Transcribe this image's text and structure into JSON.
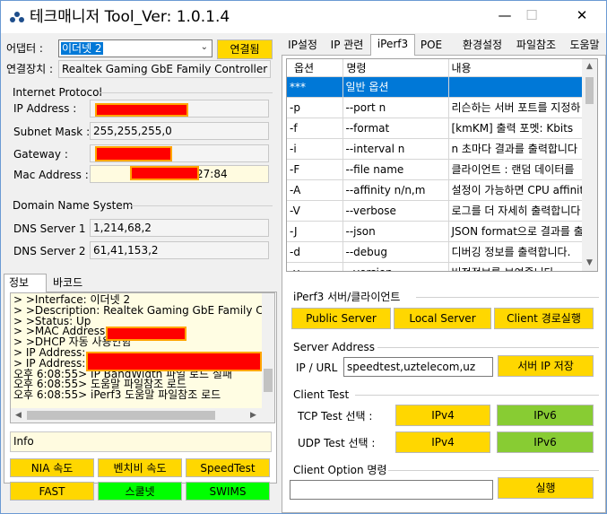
{
  "window": {
    "title": "테크매니저 Tool_Ver: 1.0.1.4",
    "minimize": "—",
    "maximize": "☐",
    "close": "✕"
  },
  "adapter": {
    "label": "어댑터 :",
    "value": "이더넷 2",
    "status_button": "연결됨",
    "device_label": "연결장치 :",
    "device_value": "Realtek Gaming GbE Family Controller"
  },
  "ip": {
    "group_title": "Internet Protocol",
    "address_label": "IP Address :",
    "subnet_label": "Subnet Mask :",
    "subnet_value": "255,255,255,0",
    "gateway_label": "Gateway :",
    "mac_label": "Mac Address :",
    "mac_value": "27:84"
  },
  "dns": {
    "group_title": "Domain Name System",
    "dns1_label": "DNS Server 1 :",
    "dns1_value": "1,214,68,2",
    "dns2_label": "DNS Server 2 :",
    "dns2_value": "61,41,153,2"
  },
  "left_tabs": [
    "정보",
    "바코드"
  ],
  "log_lines": [
    "> >Interface: 이더넷 2",
    "> >Description: Realtek Gaming GbE Family Cor",
    "> >Status: Up",
    "> >MAC Address:",
    "> >DHCP 자동 사용안함",
    "> IP Address:",
    "> IP Address:",
    "오후 6:08:55> IP BandWidth 파일 로드 실패",
    "오후 6:08:55> 도움말 파일참조 로드",
    "오후 6:08:55> iPerf3 도움말 파일참조 로드"
  ],
  "info_field": "Info",
  "left_buttons": {
    "nia": "NIA 속도",
    "benchbee": "벤치비 속도",
    "speedtest": "SpeedTest",
    "fast": "FAST",
    "school": "스쿨넷",
    "swims": "SWIMS"
  },
  "right_tabs": [
    "IP설정",
    "IP 관련",
    "iPerf3",
    "POE",
    "환경설정",
    "파일참조",
    "도움말"
  ],
  "option_table": {
    "headers": [
      "옵션",
      "명령",
      "내용"
    ],
    "rows": [
      [
        "***",
        "일반 옵션",
        ""
      ],
      [
        "-p",
        "--port n",
        "리슨하는 서버 포트를 지정하"
      ],
      [
        "-f",
        "--format",
        "[kmKM]   출력 포멧: Kbits"
      ],
      [
        "-i",
        "--interval n",
        "n 초마다 결과를 출력합니다"
      ],
      [
        "-F",
        "--file name",
        "클라이언트 : 랜덤 데이터를"
      ],
      [
        "-A",
        "--affinity n/n,m",
        "설정이 가능하면 CPU affinit"
      ],
      [
        "-V",
        "--verbose",
        "로그를 더 자세히 출력합니다"
      ],
      [
        "-J",
        "--json",
        "JSON format으로 결과를 출"
      ],
      [
        "-d",
        "--debug",
        "디버깅 정보를 출력합니다."
      ],
      [
        "-v",
        "--version",
        "버전정보를 보여줍니다"
      ]
    ]
  },
  "iperf_group": {
    "title": "iPerf3 서버/클라이언트",
    "public_server": "Public Server",
    "local_server": "Local Server",
    "client_run": "Client 경로실행"
  },
  "server_address": {
    "title": "Server Address",
    "label": "IP / URL",
    "value": "speedtest,uztelecom,uz",
    "save_button": "서버 IP 저장"
  },
  "client_test": {
    "title": "Client Test",
    "tcp_label": "TCP Test 선택 :",
    "udp_label": "UDP Test 선택 :",
    "ipv4": "IPv4",
    "ipv6": "IPv6"
  },
  "client_option": {
    "title": "Client Option 명령",
    "value": "",
    "run_button": "실행"
  },
  "colors": {
    "yellow_button": "#ffd700",
    "green_button": "#00ff00",
    "olive_button": "#88cc33",
    "selection": "#0078d7",
    "redaction": "#ff0000"
  }
}
